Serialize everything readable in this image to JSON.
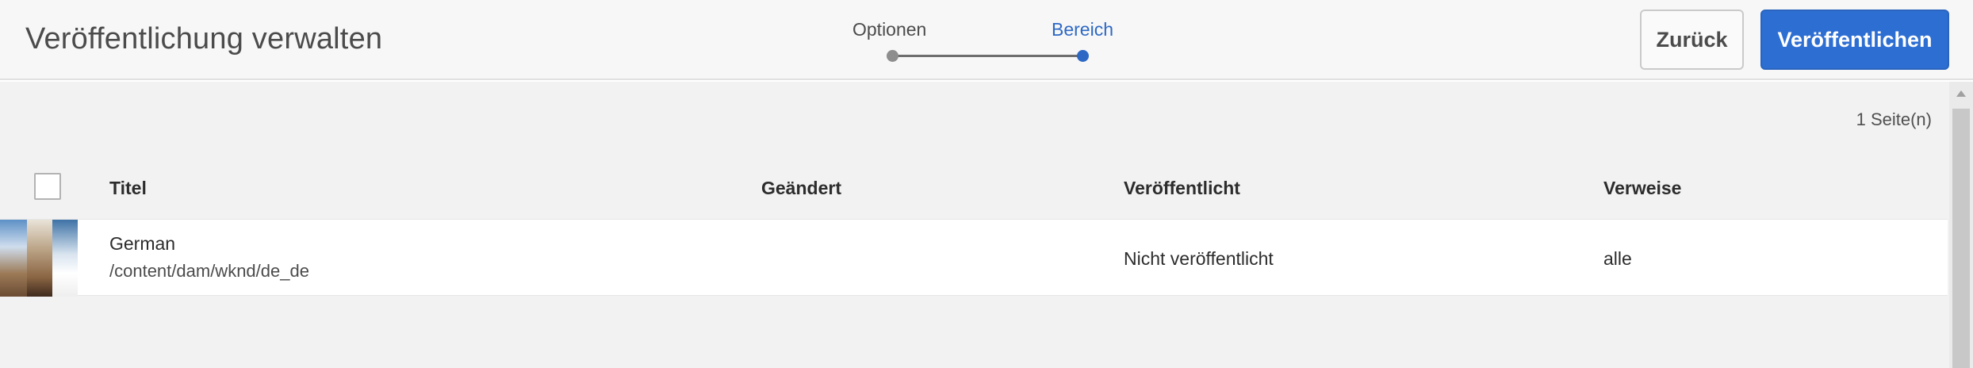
{
  "header": {
    "title": "Veröffentlichung verwalten",
    "steps": [
      {
        "label": "Optionen",
        "state": "done"
      },
      {
        "label": "Bereich",
        "state": "active"
      }
    ],
    "back_label": "Zurück",
    "publish_label": "Veröffentlichen"
  },
  "list": {
    "count_label": "1 Seite(n)",
    "columns": [
      "Titel",
      "Geändert",
      "Veröffentlicht",
      "Verweise"
    ],
    "rows": [
      {
        "title": "German",
        "path": "/content/dam/wknd/de_de",
        "modified": "",
        "published": "Nicht veröffentlicht",
        "references": "alle"
      }
    ]
  },
  "colors": {
    "accent": "#2d6ed2",
    "step_active": "#2d68c4",
    "step_done": "#8e8e8e"
  },
  "icons": [
    "folder-thumbnail-icon",
    "scroll-up-arrow-icon"
  ]
}
